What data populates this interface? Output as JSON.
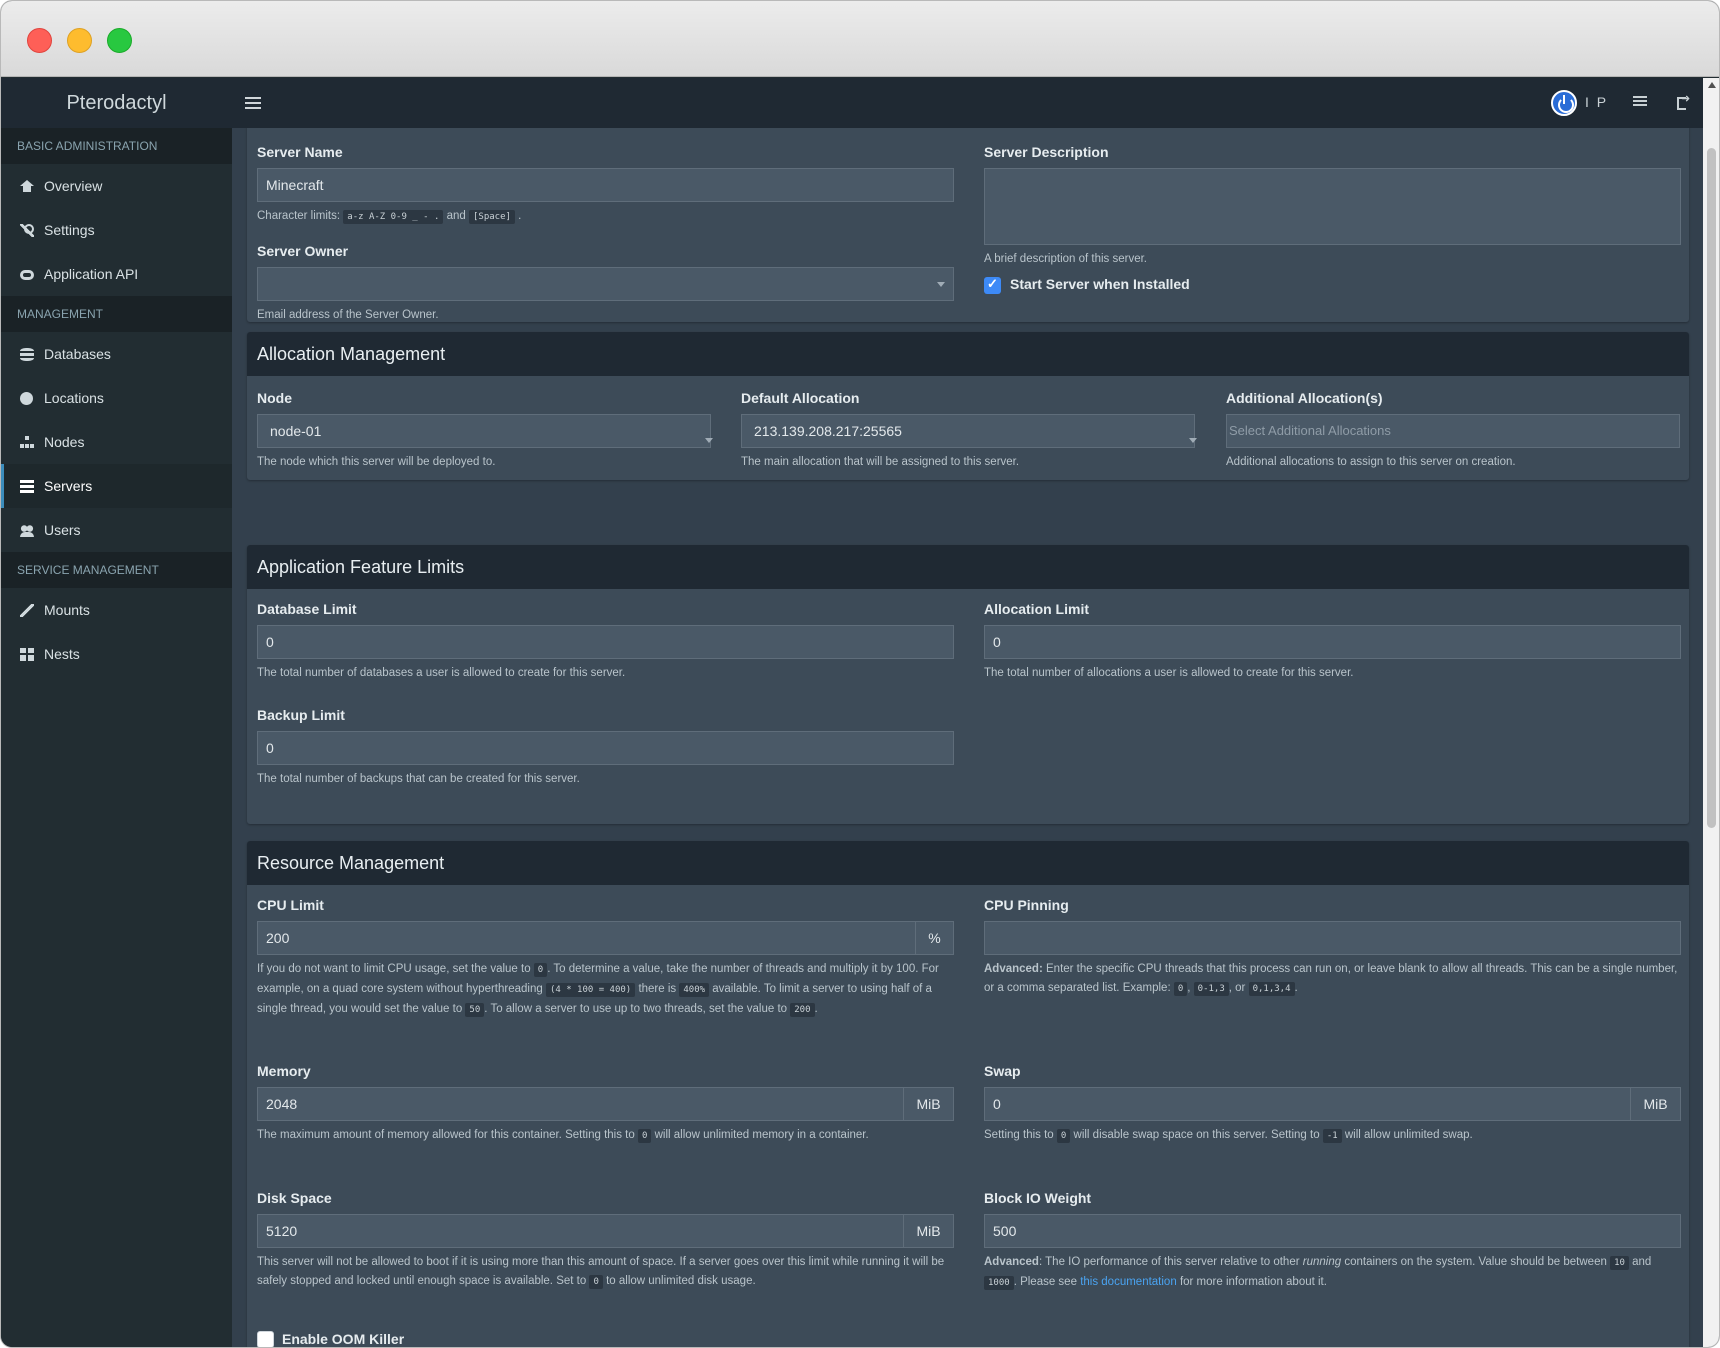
{
  "brand": "Pterodactyl",
  "topbar": {
    "user_initials": "I P"
  },
  "sidebar": {
    "sections": [
      {
        "header": "BASIC ADMINISTRATION",
        "items": [
          {
            "label": "Overview",
            "icon": "home-icon"
          },
          {
            "label": "Settings",
            "icon": "wrench-icon"
          },
          {
            "label": "Application API",
            "icon": "gamepad-icon"
          }
        ]
      },
      {
        "header": "MANAGEMENT",
        "items": [
          {
            "label": "Databases",
            "icon": "database-icon"
          },
          {
            "label": "Locations",
            "icon": "globe-icon"
          },
          {
            "label": "Nodes",
            "icon": "sitemap-icon"
          },
          {
            "label": "Servers",
            "icon": "server-icon",
            "active": true
          },
          {
            "label": "Users",
            "icon": "users-icon"
          }
        ]
      },
      {
        "header": "SERVICE MANAGEMENT",
        "items": [
          {
            "label": "Mounts",
            "icon": "magic-icon"
          },
          {
            "label": "Nests",
            "icon": "grid-icon"
          }
        ]
      }
    ]
  },
  "core": {
    "server_name_label": "Server Name",
    "server_name_value": "Minecraft",
    "server_name_help_prefix": "Character limits:",
    "server_name_code1": "a-z A-Z 0-9 _ - .",
    "server_name_help_and": "and",
    "server_name_code2": "[Space]",
    "server_name_help_suffix": ".",
    "server_owner_label": "Server Owner",
    "server_owner_value": "",
    "server_owner_help": "Email address of the Server Owner.",
    "description_label": "Server Description",
    "description_help": "A brief description of this server.",
    "start_label": "Start Server when Installed",
    "start_checked": true
  },
  "allocation": {
    "title": "Allocation Management",
    "node_label": "Node",
    "node_value": "node-01",
    "node_help": "The node which this server will be deployed to.",
    "default_label": "Default Allocation",
    "default_value": "213.139.208.217:25565",
    "default_help": "The main allocation that will be assigned to this server.",
    "additional_label": "Additional Allocation(s)",
    "additional_placeholder": "Select Additional Allocations",
    "additional_help": "Additional allocations to assign to this server on creation."
  },
  "features": {
    "title": "Application Feature Limits",
    "database_label": "Database Limit",
    "database_value": "0",
    "database_help": "The total number of databases a user is allowed to create for this server.",
    "allocation_label": "Allocation Limit",
    "allocation_value": "0",
    "allocation_help": "The total number of allocations a user is allowed to create for this server.",
    "backup_label": "Backup Limit",
    "backup_value": "0",
    "backup_help": "The total number of backups that can be created for this server."
  },
  "resources": {
    "title": "Resource Management",
    "cpu_label": "CPU Limit",
    "cpu_value": "200",
    "cpu_unit": "%",
    "cpu_help": {
      "t1": "If you do not want to limit CPU usage, set the value to",
      "c1": "0",
      "t2": ". To determine a value, take the number of threads and multiply it by 100. For example, on a quad core system without hyperthreading",
      "c2": "(4 * 100 = 400)",
      "t3": "there is",
      "c3": "400%",
      "t4": "available. To limit a server to using half of a single thread, you would set the value to",
      "c4": "50",
      "t5": ". To allow a server to use up to two threads, set the value to",
      "c5": "200",
      "t6": "."
    },
    "pinning_label": "CPU Pinning",
    "pinning_value": "",
    "pinning_help": {
      "bold": "Advanced:",
      "t1": "Enter the specific CPU threads that this process can run on, or leave blank to allow all threads. This can be a single number, or a comma separated list. Example:",
      "c1": "0",
      "t2": ",",
      "c2": "0-1,3",
      "t3": ", or",
      "c3": "0,1,3,4",
      "t4": "."
    },
    "memory_label": "Memory",
    "memory_value": "2048",
    "memory_unit": "MiB",
    "memory_help": {
      "t1": "The maximum amount of memory allowed for this container. Setting this to",
      "c1": "0",
      "t2": "will allow unlimited memory in a container."
    },
    "swap_label": "Swap",
    "swap_value": "0",
    "swap_unit": "MiB",
    "swap_help": {
      "t1": "Setting this to",
      "c1": "0",
      "t2": "will disable swap space on this server. Setting to",
      "c2": "-1",
      "t3": "will allow unlimited swap."
    },
    "disk_label": "Disk Space",
    "disk_value": "5120",
    "disk_unit": "MiB",
    "disk_help": {
      "t1": "This server will not be allowed to boot if it is using more than this amount of space. If a server goes over this limit while running it will be safely stopped and locked until enough space is available. Set to",
      "c1": "0",
      "t2": "to allow unlimited disk usage."
    },
    "io_label": "Block IO Weight",
    "io_value": "500",
    "io_help": {
      "bold": "Advanced",
      "t1": ": The IO performance of this server relative to other",
      "em": "running",
      "t2": "containers on the system. Value should be between",
      "c1": "10",
      "t3": "and",
      "c2": "1000",
      "t4": ". Please see",
      "link": "this documentation",
      "t5": "for more information about it."
    },
    "oom_label": "Enable OOM Killer",
    "oom_checked": false
  }
}
